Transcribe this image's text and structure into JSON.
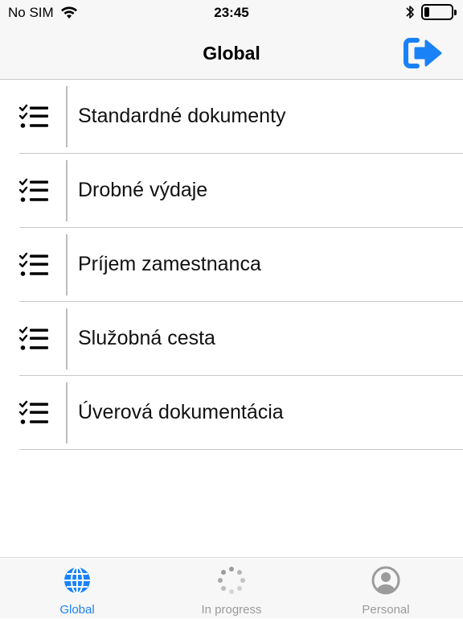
{
  "status_bar": {
    "carrier": "No SIM",
    "time": "23:45",
    "battery_level": 0.2
  },
  "nav": {
    "title": "Global",
    "logout_icon": "logout-arrow-icon",
    "accent_color": "#1a82f7"
  },
  "list": {
    "items": [
      {
        "label": "Standardné dokumenty",
        "icon": "checklist-icon"
      },
      {
        "label": "Drobné výdaje",
        "icon": "checklist-icon"
      },
      {
        "label": "Príjem zamestnanca",
        "icon": "checklist-icon"
      },
      {
        "label": "Služobná cesta",
        "icon": "checklist-icon"
      },
      {
        "label": "Úverová dokumentácia",
        "icon": "checklist-icon"
      }
    ]
  },
  "tabs": {
    "active_color": "#1a82f7",
    "inactive_color": "#9b9b9b",
    "items": [
      {
        "label": "Global",
        "icon": "globe-icon",
        "active": true
      },
      {
        "label": "In progress",
        "icon": "spinner-icon",
        "active": false
      },
      {
        "label": "Personal",
        "icon": "person-icon",
        "active": false
      }
    ]
  }
}
